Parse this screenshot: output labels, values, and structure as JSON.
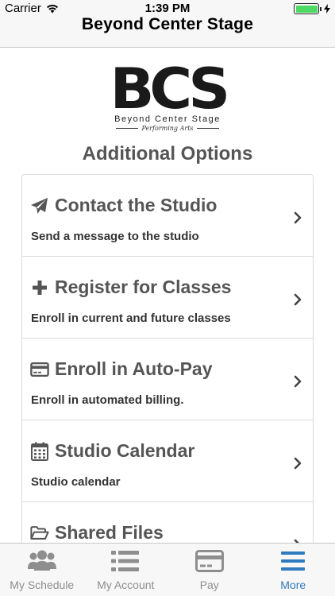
{
  "status_bar": {
    "carrier": "Carrier",
    "time": "1:39 PM",
    "battery_level": 1.0
  },
  "nav": {
    "title": "Beyond Center Stage"
  },
  "logo": {
    "mark": "BCS",
    "line1": "Beyond Center Stage",
    "line2": "Performing Arts"
  },
  "section_title": "Additional Options",
  "options": [
    {
      "icon": "paper-plane-icon",
      "title": "Contact the Studio",
      "desc": "Send a message to the studio"
    },
    {
      "icon": "plus-icon",
      "title": "Register for Classes",
      "desc": "Enroll in current and future classes"
    },
    {
      "icon": "credit-card-icon",
      "title": "Enroll in Auto-Pay",
      "desc": "Enroll in automated billing."
    },
    {
      "icon": "calendar-icon",
      "title": "Studio Calendar",
      "desc": "Studio calendar"
    },
    {
      "icon": "folder-open-icon",
      "title": "Shared Files",
      "desc": ""
    }
  ],
  "tabs": [
    {
      "icon": "users-icon",
      "label": "My Schedule",
      "active": false
    },
    {
      "icon": "list-icon",
      "label": "My Account",
      "active": false
    },
    {
      "icon": "credit-card-icon",
      "label": "Pay",
      "active": false
    },
    {
      "icon": "hamburger-menu-icon",
      "label": "More",
      "active": true
    }
  ],
  "colors": {
    "accent": "#2f7bbf",
    "inactive": "#8e8e8e",
    "text": "#555555",
    "battery": "#4cd964"
  }
}
